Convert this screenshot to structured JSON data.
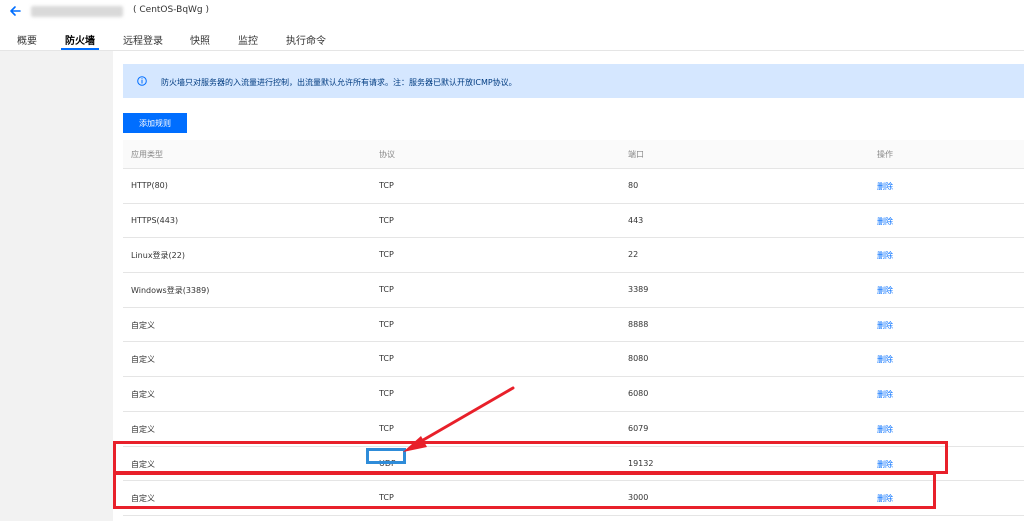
{
  "header": {
    "instance_name": "( CentOS-BqWg )"
  },
  "tabs": [
    {
      "label": "概要"
    },
    {
      "label": "防火墙",
      "active": true
    },
    {
      "label": "远程登录"
    },
    {
      "label": "快照"
    },
    {
      "label": "监控"
    },
    {
      "label": "执行命令"
    }
  ],
  "notice": {
    "text": "防火墙只对服务器的入流量进行控制，出流量默认允许所有请求。注：服务器已默认开放ICMP协议。"
  },
  "toolbar": {
    "add_rule_label": "添加规则"
  },
  "table": {
    "columns": [
      "应用类型",
      "协议",
      "端口",
      "操作"
    ],
    "rows": [
      {
        "app": "HTTP(80)",
        "protocol": "TCP",
        "port": "80",
        "action": "删除"
      },
      {
        "app": "HTTPS(443)",
        "protocol": "TCP",
        "port": "443",
        "action": "删除"
      },
      {
        "app": "Linux登录(22)",
        "protocol": "TCP",
        "port": "22",
        "action": "删除"
      },
      {
        "app": "Windows登录(3389)",
        "protocol": "TCP",
        "port": "3389",
        "action": "删除"
      },
      {
        "app": "自定义",
        "protocol": "TCP",
        "port": "8888",
        "action": "删除"
      },
      {
        "app": "自定义",
        "protocol": "TCP",
        "port": "8080",
        "action": "删除"
      },
      {
        "app": "自定义",
        "protocol": "TCP",
        "port": "6080",
        "action": "删除"
      },
      {
        "app": "自定义",
        "protocol": "TCP",
        "port": "6079",
        "action": "删除"
      },
      {
        "app": "自定义",
        "protocol": "UDP",
        "port": "19132",
        "action": "删除"
      },
      {
        "app": "自定义",
        "protocol": "TCP",
        "port": "3000",
        "action": "删除"
      }
    ]
  },
  "annotation_colors": {
    "highlight_red": "#e8202a",
    "highlight_blue": "#2e8cd9",
    "accent": "#006eff"
  }
}
